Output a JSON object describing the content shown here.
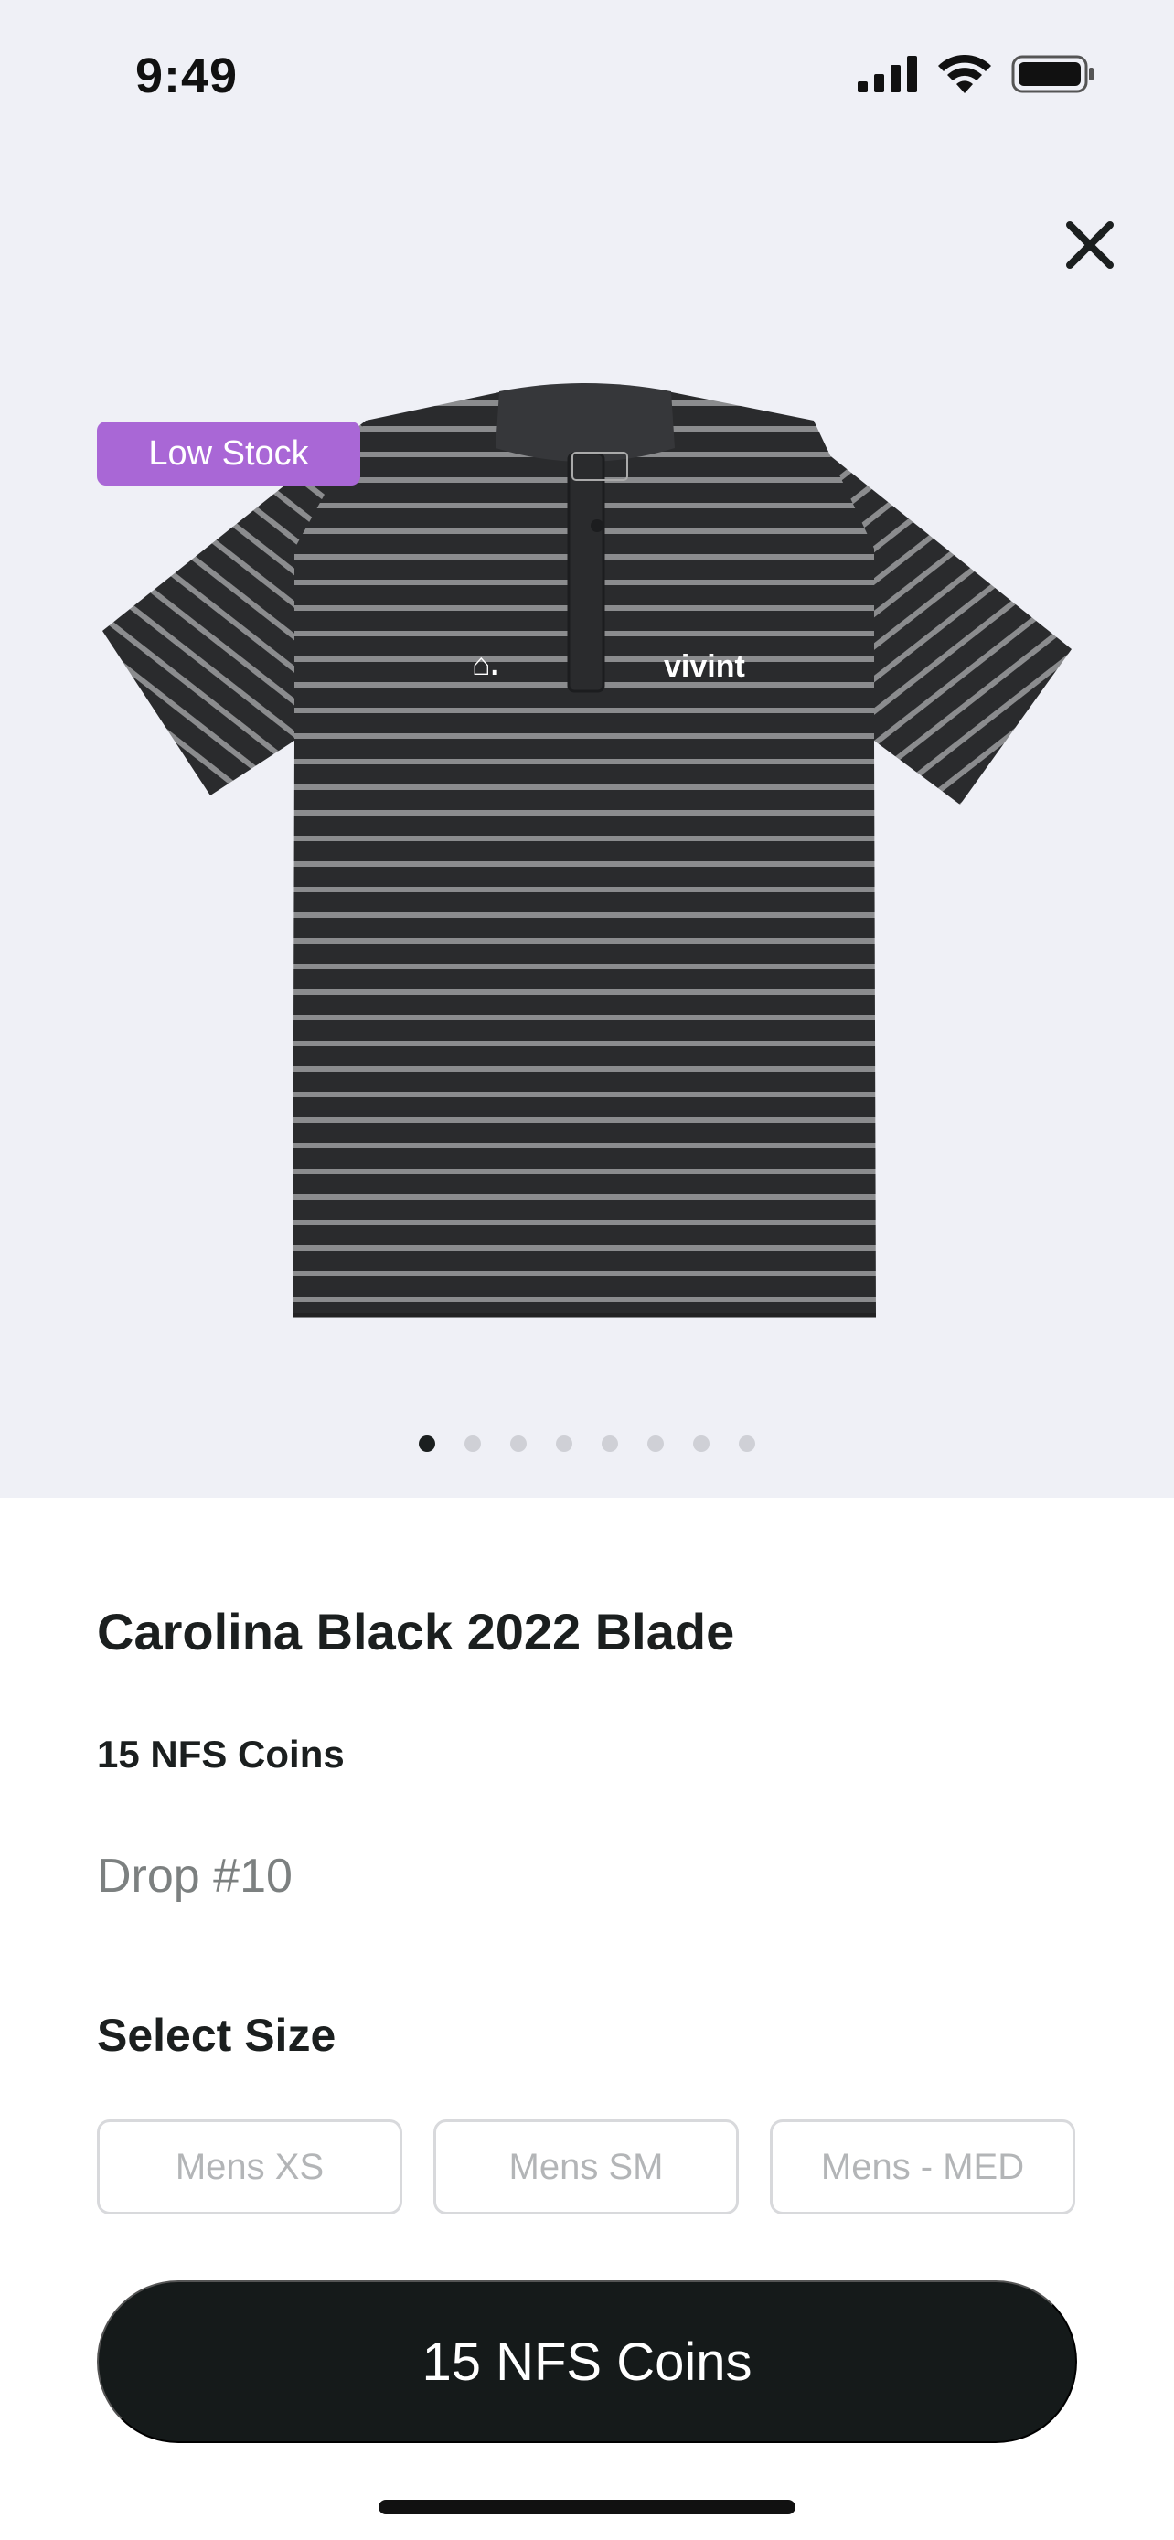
{
  "status_bar": {
    "time": "9:49",
    "icons": [
      "cellular-signal-icon",
      "wifi-icon",
      "battery-icon"
    ]
  },
  "product": {
    "badge": "Low Stock",
    "badge_color": "#a967d6",
    "title": "Carolina Black 2022 Blade",
    "price": "15 NFS Coins",
    "drop": "Drop #10",
    "image_text": {
      "logo_mark": "⌂.",
      "brand": "vivint"
    },
    "carousel": {
      "total": 8,
      "active_index": 0
    }
  },
  "sizes": {
    "heading": "Select Size",
    "options": [
      "Mens XS",
      "Mens SM",
      "Mens - MED"
    ]
  },
  "purchase": {
    "button_label": "15 NFS Coins",
    "button_color": "#151a1a"
  }
}
